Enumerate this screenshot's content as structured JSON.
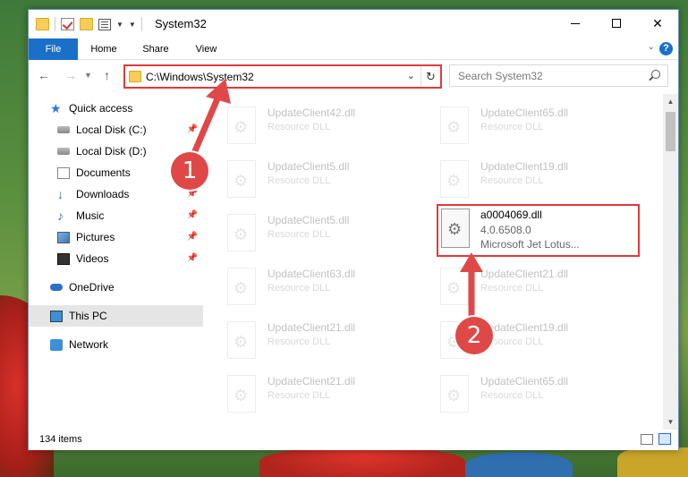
{
  "window": {
    "title": "System32",
    "controls": {
      "minimize": "—",
      "maximize": "☐",
      "close": "✕"
    }
  },
  "ribbon": {
    "tabs": [
      "File",
      "Home",
      "Share",
      "View"
    ],
    "help": "?"
  },
  "navbar": {
    "address": "C:\\Windows\\System32",
    "search_placeholder": "Search System32"
  },
  "sidebar": {
    "items": [
      {
        "label": "Quick access",
        "icon": "star-icon",
        "pinned": false
      },
      {
        "label": "Local Disk (C:)",
        "icon": "drive-icon",
        "pinned": true
      },
      {
        "label": "Local Disk (D:)",
        "icon": "drive-icon",
        "pinned": false
      },
      {
        "label": "Documents",
        "icon": "documents-icon",
        "pinned": true
      },
      {
        "label": "Downloads",
        "icon": "downloads-icon",
        "pinned": true
      },
      {
        "label": "Music",
        "icon": "music-icon",
        "pinned": true
      },
      {
        "label": "Pictures",
        "icon": "pictures-icon",
        "pinned": true
      },
      {
        "label": "Videos",
        "icon": "videos-icon",
        "pinned": true
      },
      {
        "label": "OneDrive",
        "icon": "onedrive-icon",
        "pinned": false
      },
      {
        "label": "This PC",
        "icon": "this-pc-icon",
        "pinned": false,
        "selected": true
      },
      {
        "label": "Network",
        "icon": "network-icon",
        "pinned": false
      }
    ]
  },
  "files": {
    "left_column": [
      {
        "name": "UpdateClient42.dll",
        "desc": "Resource DLL"
      },
      {
        "name": "UpdateClient5.dll",
        "desc": "Resource DLL"
      },
      {
        "name": "UpdateClient5.dll",
        "desc": "Resource DLL"
      },
      {
        "name": "UpdateClient63.dll",
        "desc": "Resource DLL"
      },
      {
        "name": "UpdateClient21.dll",
        "desc": "Resource DLL"
      },
      {
        "name": "UpdateClient21.dll",
        "desc": "Resource DLL"
      }
    ],
    "right_column": [
      {
        "name": "UpdateClient65.dll",
        "desc": "Resource DLL"
      },
      {
        "name": "UpdateClient19.dll",
        "desc": "Resource DLL"
      },
      {
        "name": "UpdateClient21.dll",
        "desc": "Resource DLL"
      },
      {
        "name": "UpdateClient19.dll",
        "desc": "Resource DLL"
      },
      {
        "name": "UpdateClient65.dll",
        "desc": "Resource DLL"
      }
    ],
    "highlighted": {
      "name": "a0004069.dll",
      "version": "4.0.6508.0",
      "desc": "Microsoft Jet Lotus..."
    }
  },
  "statusbar": {
    "count": "134 items"
  },
  "annotations": {
    "step1": "1",
    "step2": "2"
  },
  "colors": {
    "accent": "#1a6fc9",
    "annotation": "#e04848"
  }
}
